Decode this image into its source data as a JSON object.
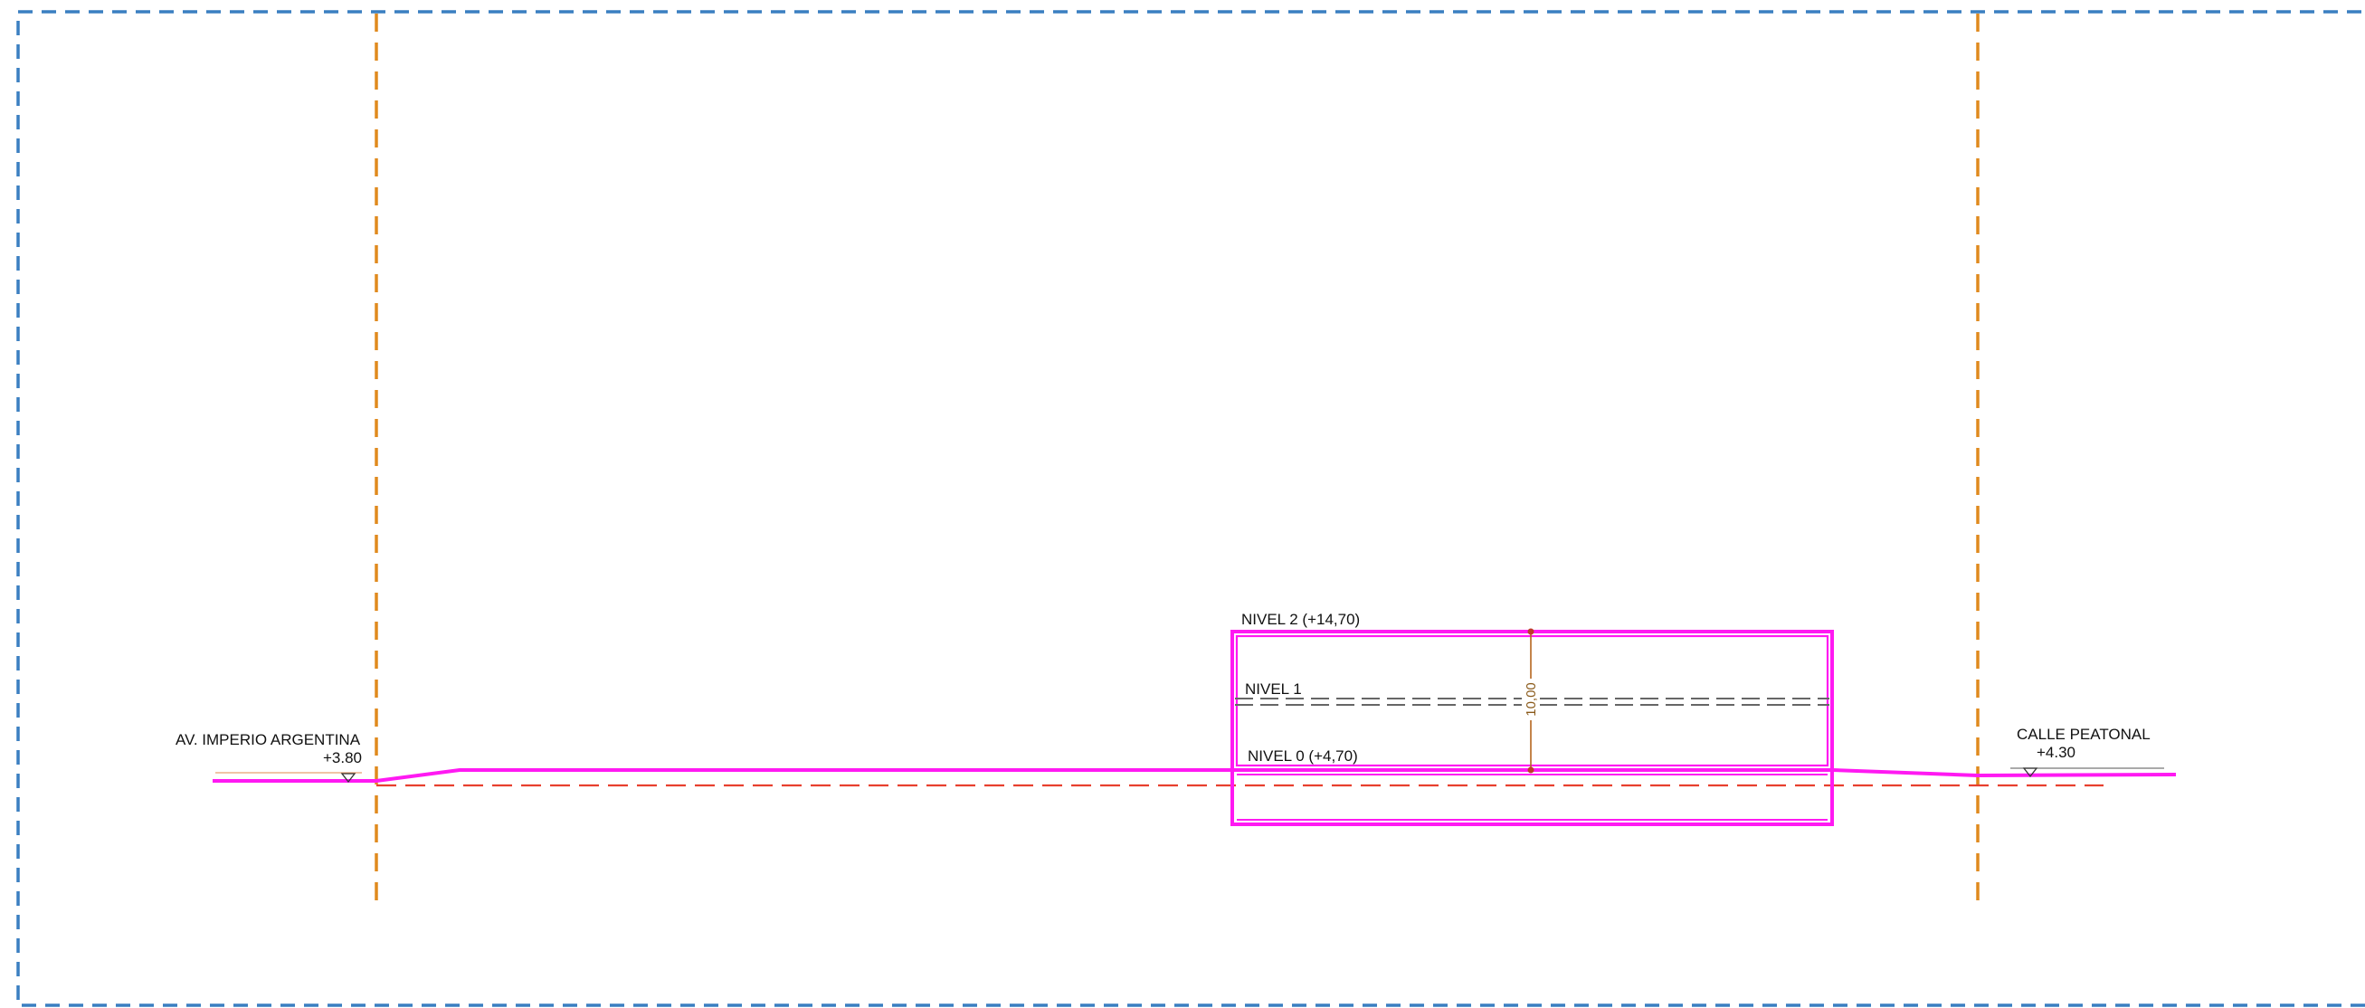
{
  "colors": {
    "border": "#3a7fc1",
    "axis": "#e08a1e",
    "building": "#ff19f2",
    "datum": "#e8402f",
    "level": "#666666",
    "dimension": "#b5651d",
    "text": "#111111"
  },
  "labels": {
    "left_street": "AV. IMPERIO ARGENTINA",
    "left_elevation": "+3.80",
    "right_street": "CALLE PEATONAL",
    "right_elevation": "+4.30",
    "level_2": "NIVEL 2 (+14,70)",
    "level_1": "NIVEL 1",
    "level_0": "NIVEL 0 (+4,70)",
    "dimension_height": "10,00"
  }
}
